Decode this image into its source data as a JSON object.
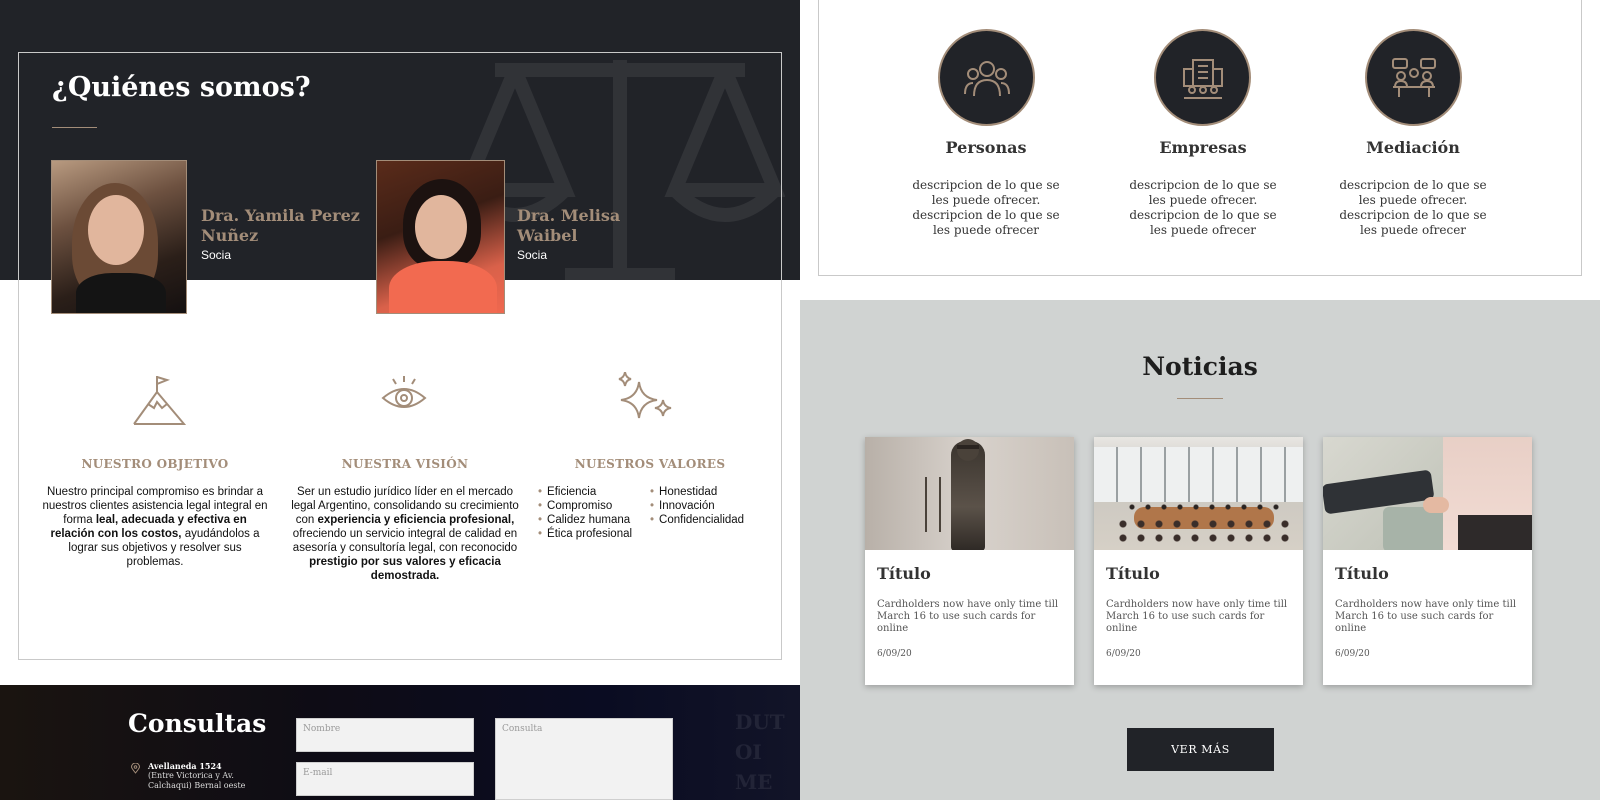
{
  "about": {
    "title": "¿Quiénes somos?",
    "members": [
      {
        "name": "Dra. Yamila Perez Nuñez",
        "role": "Socia"
      },
      {
        "name": "Dra. Melisa Waibel",
        "role": "Socia"
      }
    ],
    "pillars": {
      "objective": {
        "title": "NUESTRO OBJETIVO",
        "text_1": "Nuestro principal compromiso es brindar a nuestros clientes asistencia legal integral en forma ",
        "bold_1": "leal, adecuada y efectiva en relación con los costos,",
        "text_2": " ayudándolos a lograr sus objetivos y resolver sus problemas."
      },
      "vision": {
        "title": "NUESTRA VISIÓN",
        "text_1": "Ser un estudio jurídico líder en el mercado legal Argentino, consolidando su crecimiento con ",
        "bold_1": "experiencia y eficiencia profesional,",
        "text_2": " ofreciendo un servicio integral de calidad en asesoría y consultoría legal, con reconocido ",
        "bold_2": "prestigio por sus valores y eficacia demostrada."
      },
      "values": {
        "title": "NUESTROS VALORES",
        "col_1": [
          "Eficiencia",
          "Compromiso",
          "Calidez humana",
          "Ética profesional"
        ],
        "col_2": [
          "Honestidad",
          "Innovación",
          "Confidencialidad"
        ]
      }
    }
  },
  "contact": {
    "title": "Consultas",
    "address_strong": "Avellaneda 1524",
    "address_detail": "(Entre Victorica y Av. Calchaqui) Bernal oeste",
    "placeholders": {
      "name": "Nombre",
      "email": "E-mail",
      "message": "Consulta"
    },
    "deco_text": "DUT OI ME"
  },
  "services": [
    {
      "title": "Personas",
      "text": "descripcion de lo que se les puede ofrecer. descripcion de lo que se les puede ofrecer",
      "icon": "people-group-icon"
    },
    {
      "title": "Empresas",
      "text": "descripcion de lo que se les puede ofrecer. descripcion de lo que se les puede ofrecer",
      "icon": "company-building-icon"
    },
    {
      "title": "Mediación",
      "text": "descripcion de lo que se les puede ofrecer. descripcion de lo que se les puede ofrecer",
      "icon": "mediation-meeting-icon"
    }
  ],
  "news": {
    "title": "Noticias",
    "cards": [
      {
        "title": "Título",
        "text": "Cardholders now have only time till March 16 to use such cards for online",
        "date": "6/09/20",
        "image": "lady-justice-statue"
      },
      {
        "title": "Título",
        "text": "Cardholders now have only time till March 16 to use such cards for online",
        "date": "6/09/20",
        "image": "meeting-room"
      },
      {
        "title": "Título",
        "text": "Cardholders now have only time till March 16 to use such cards for online",
        "date": "6/09/20",
        "image": "consultation-couch"
      }
    ],
    "more_label": "VER MÁS"
  },
  "colors": {
    "accent": "#a38d79",
    "dark": "#212328",
    "news_bg": "#d0d3d2"
  }
}
